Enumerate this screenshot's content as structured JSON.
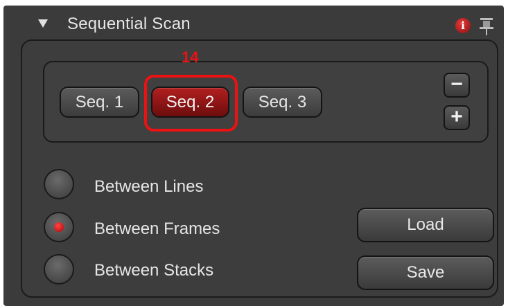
{
  "panel": {
    "title": "Sequential Scan",
    "collapse_icon": "triangle-down-icon",
    "info_icon": "info-icon",
    "info_glyph": "i",
    "pin_icon": "pin-icon"
  },
  "annotation": {
    "number": "14",
    "color": "#ee1111"
  },
  "sequences": {
    "tabs": [
      {
        "label": "Seq. 1",
        "active": false
      },
      {
        "label": "Seq. 2",
        "active": true
      },
      {
        "label": "Seq. 3",
        "active": false
      }
    ],
    "remove_icon": "minus-icon",
    "remove_glyph": "−",
    "add_icon": "plus-icon",
    "add_glyph": "+",
    "active_color": "#a01616"
  },
  "scan_modes": {
    "options": [
      {
        "label": "Between Lines",
        "selected": false
      },
      {
        "label": "Between Frames",
        "selected": true
      },
      {
        "label": "Between Stacks",
        "selected": false
      }
    ]
  },
  "actions": {
    "load_label": "Load",
    "save_label": "Save"
  }
}
